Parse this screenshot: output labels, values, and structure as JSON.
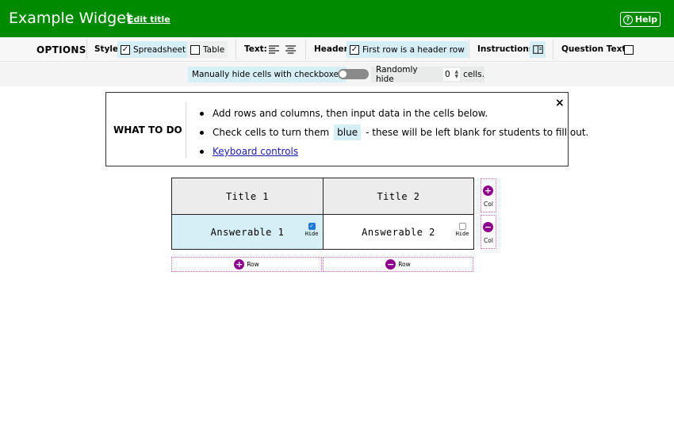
{
  "header": {
    "title": "Example Widget",
    "edit_title": "Edit title",
    "help": "Help",
    "help_glyph": "?"
  },
  "options": {
    "title": "OPTIONS",
    "style_label": "Style:",
    "style_spreadsheet": "Spreadsheet",
    "style_table": "Table",
    "style_selected": "Spreadsheet",
    "text_label": "Text:",
    "text_align_left_icon": "align-left-icon",
    "text_align_center_icon": "align-center-icon",
    "header_label": "Header:",
    "header_checkbox_label": "First row is a header row",
    "header_checked": true,
    "instructions_label": "Instructions:",
    "instructions_icon": "book-icon",
    "question_text_label": "Question Text:",
    "question_text_checked": false,
    "check_glyph": "✓"
  },
  "hide_bar": {
    "manual_label": "Manually hide cells with checkboxes",
    "manual_toggle_on": false,
    "random_label": "Randomly hide",
    "random_value": "0",
    "cells_suffix": "cells."
  },
  "instructions": {
    "title": "WHAT TO DO",
    "items": [
      "Add rows and columns, then input data in the cells below.",
      "Check cells to turn them",
      "blue",
      "- these will be left blank for students to fill out.",
      "Keyboard controls"
    ],
    "close": "×"
  },
  "table": {
    "header": [
      "Title 1",
      "Title 2"
    ],
    "rows": [
      {
        "cells": [
          "Answerable 1",
          "Answerable 2"
        ],
        "hidden": [
          true,
          false
        ]
      }
    ],
    "hide_label": "Hide",
    "check_glyph": "✓"
  },
  "controls": {
    "add_col": "Col",
    "remove_col": "Col",
    "add_row": "Row",
    "remove_row": "Row",
    "plus": "+",
    "minus": "−"
  },
  "colors": {
    "header_green": "#008a00",
    "selection_blue": "#d6eef6",
    "control_purple": "#8c008c"
  }
}
